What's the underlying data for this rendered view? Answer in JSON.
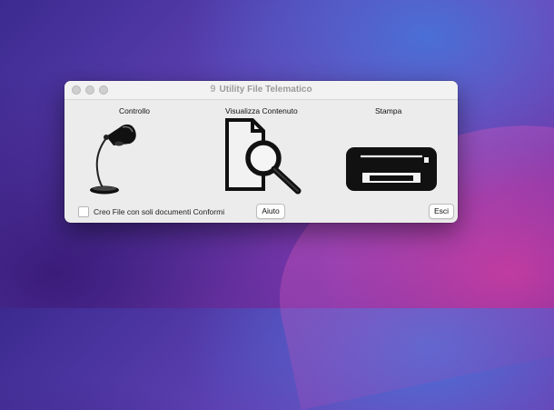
{
  "window": {
    "title": "Utility File Telematico",
    "title_icon": "9"
  },
  "sections": {
    "controllo": {
      "label": "Controllo",
      "icon": "desk-lamp-icon"
    },
    "visualizza": {
      "label": "Visualizza Contenuto",
      "icon": "document-search-icon"
    },
    "stampa": {
      "label": "Stampa",
      "icon": "printer-icon"
    }
  },
  "footer": {
    "checkbox_label": "Creo File con soli documenti Conformi",
    "checkbox_checked": false,
    "help_label": "Aiuto",
    "exit_label": "Esci"
  },
  "colors": {
    "window_bg": "#ececec",
    "icon_color": "#111111"
  }
}
